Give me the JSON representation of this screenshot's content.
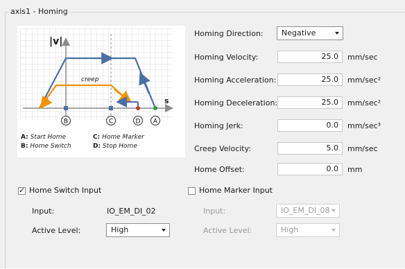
{
  "group": {
    "title": "axis1 - Homing"
  },
  "diagram": {
    "y_axis_label": "|v|",
    "x_axis_label": "s",
    "creep_label": "creep",
    "markers": [
      "B",
      "C",
      "D",
      "A"
    ],
    "legend": {
      "a": {
        "key": "A:",
        "text": "Start Home"
      },
      "b": {
        "key": "B:",
        "text": "Home Switch"
      },
      "c": {
        "key": "C:",
        "text": "Home Marker"
      },
      "d": {
        "key": "D:",
        "text": "Stop Home"
      }
    },
    "colors": {
      "fast": "#4a6fa5",
      "creep": "#f39200",
      "grid": "#dcdcdc",
      "start": "#2e9e3e",
      "stop": "#c0392b"
    }
  },
  "fields": {
    "direction": {
      "label": "Homing Direction:",
      "value": "Negative"
    },
    "velocity": {
      "label": "Homing Velocity:",
      "value": "25.0",
      "unit": "mm/sec"
    },
    "acceleration": {
      "label": "Homing Acceleration:",
      "value": "25.0",
      "unit": "mm/sec²"
    },
    "deceleration": {
      "label": "Homing Deceleration:",
      "value": "25.0",
      "unit": "mm/sec²"
    },
    "jerk": {
      "label": "Homing Jerk:",
      "value": "0.0",
      "unit": "mm/sec³"
    },
    "creep": {
      "label": "Creep Velocity:",
      "value": "5.0",
      "unit": "mm/sec"
    },
    "offset": {
      "label": "Home Offset:",
      "value": "0.0",
      "unit": "mm"
    }
  },
  "home_switch": {
    "checkbox_label": "Home Switch Input",
    "checked": true,
    "input_label": "Input:",
    "input_value": "IO_EM_DI_02",
    "level_label": "Active Level:",
    "level_value": "High"
  },
  "home_marker": {
    "checkbox_label": "Home Marker Input",
    "checked": false,
    "input_label": "Input:",
    "input_value": "IO_EM_DI_08",
    "level_label": "Active Level:",
    "level_value": "High"
  }
}
